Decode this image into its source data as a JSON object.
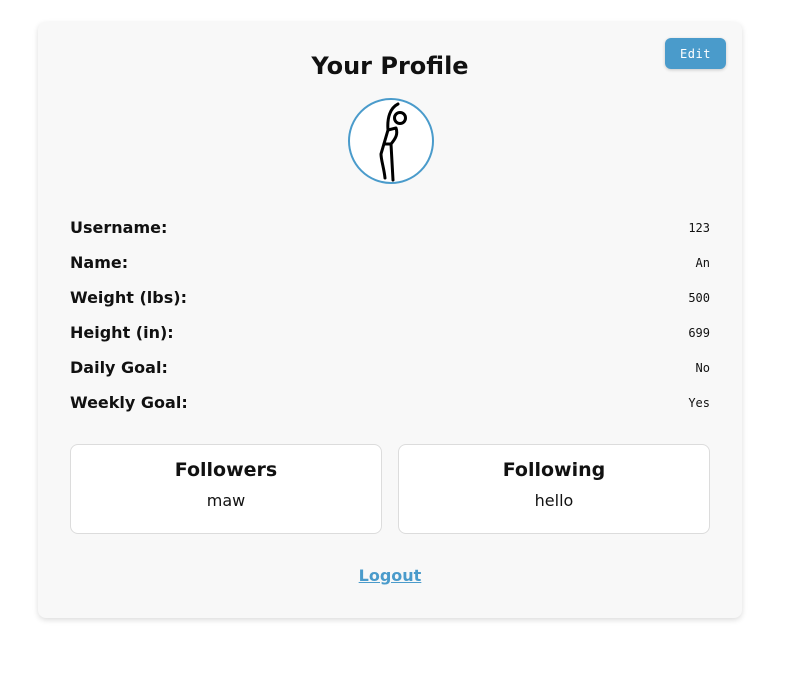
{
  "header": {
    "title": "Your Profile",
    "edit_label": "Edit"
  },
  "avatar": {
    "icon": "stretching-person-icon",
    "ring_color": "#4a9bcb"
  },
  "profile": {
    "fields": [
      {
        "label": "Username:",
        "value": "123"
      },
      {
        "label": "Name:",
        "value": "An"
      },
      {
        "label": "Weight (lbs):",
        "value": "500"
      },
      {
        "label": "Height (in):",
        "value": "699"
      },
      {
        "label": "Daily Goal:",
        "value": "No"
      },
      {
        "label": "Weekly Goal:",
        "value": "Yes"
      }
    ]
  },
  "followers": {
    "title": "Followers",
    "value": "maw"
  },
  "following": {
    "title": "Following",
    "value": "hello"
  },
  "footer": {
    "logout_label": "Logout"
  },
  "colors": {
    "accent": "#4a9bcb",
    "card_background": "#f8f8f8"
  }
}
